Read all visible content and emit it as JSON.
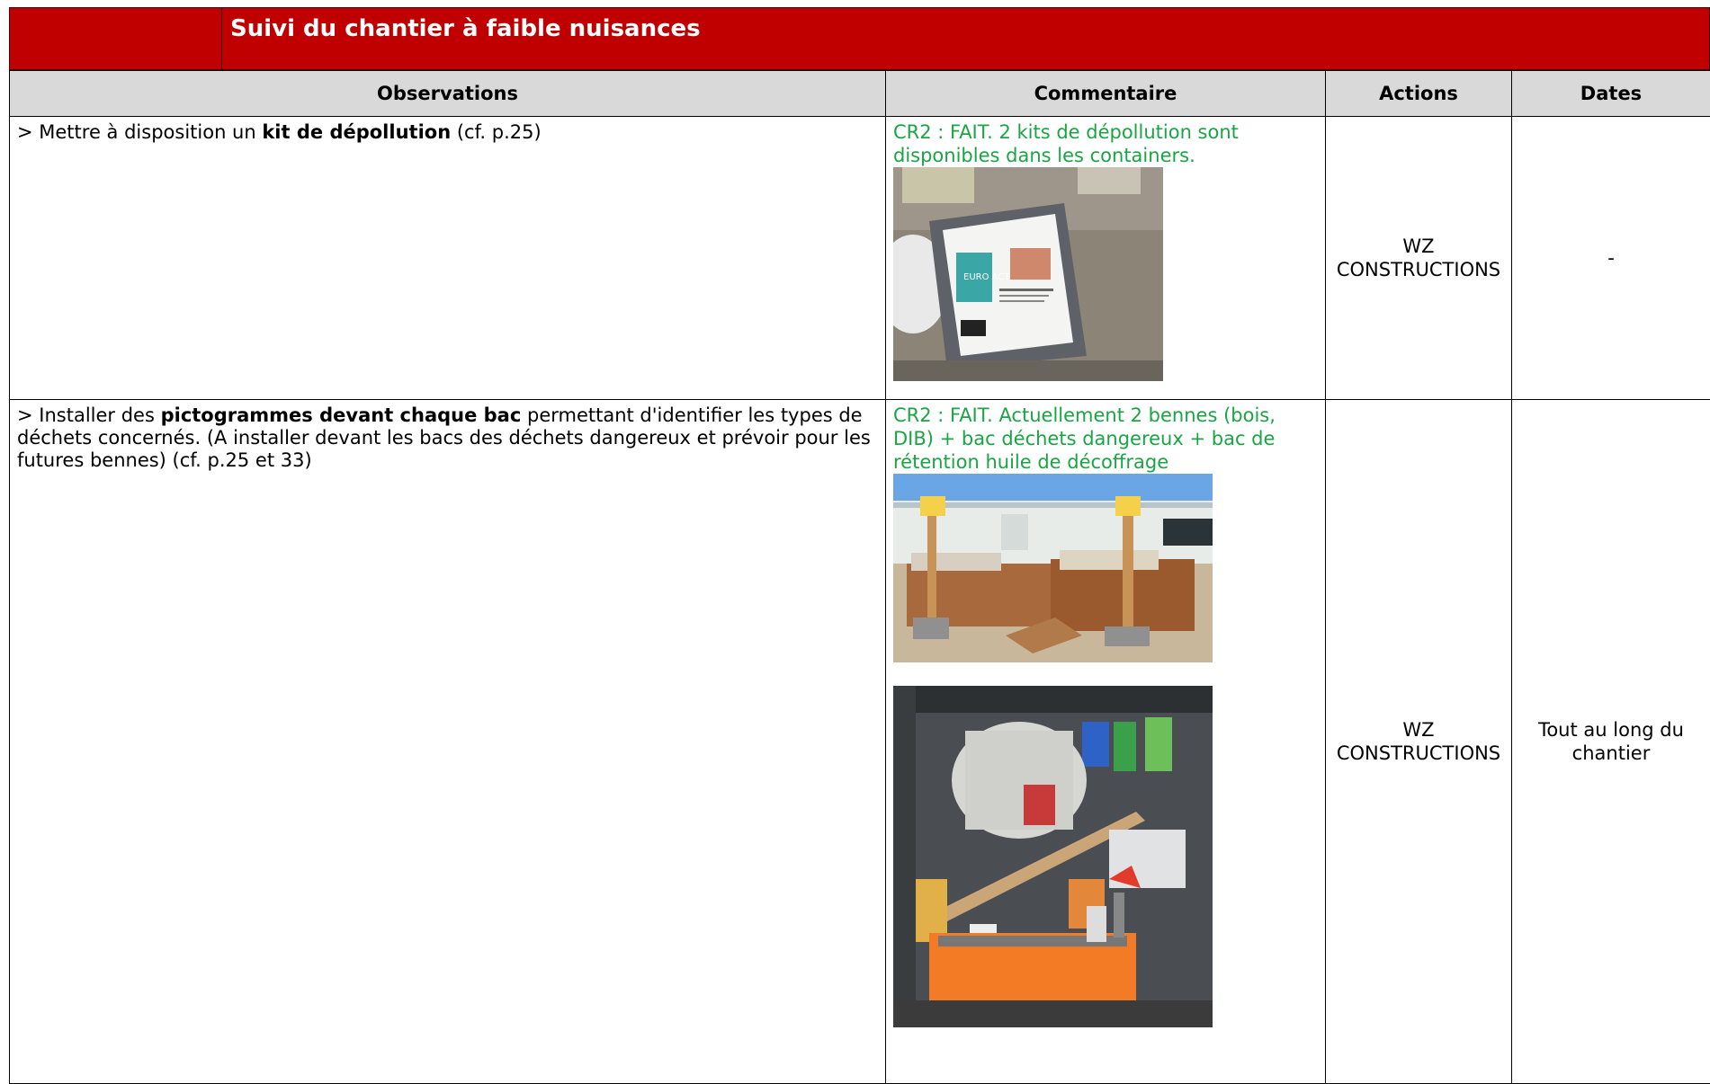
{
  "section_title": "Suivi du chantier à faible nuisances",
  "headers": {
    "observations": "Observations",
    "commentaire": "Commentaire",
    "actions": "Actions",
    "dates": "Dates"
  },
  "rows": [
    {
      "obs_prefix": "> Mettre à disposition un ",
      "obs_bold": "kit de dépollution",
      "obs_suffix": " (cf. p.25)",
      "commentaire": "CR2 : FAIT. 2 kits de dépollution sont disponibles dans les containers.",
      "actions_line1": "WZ",
      "actions_line2": "CONSTRUCTIONS",
      "dates": "-"
    },
    {
      "obs_prefix": "> Installer des ",
      "obs_bold": "pictogrammes devant chaque bac",
      "obs_suffix": " permettant d'identifier les types de déchets concernés. (A installer devant les bacs des déchets dangereux et prévoir pour les futures bennes) (cf. p.25 et 33)",
      "commentaire": "CR2 : FAIT. Actuellement 2 bennes (bois, DIB) + bac déchets dangereux + bac de rétention huile de décoffrage",
      "actions_line1": "WZ",
      "actions_line2": "CONSTRUCTIONS",
      "dates": "Tout au long du chantier"
    }
  ],
  "photo_labels": {
    "kit_brand": "EURO ACT"
  }
}
